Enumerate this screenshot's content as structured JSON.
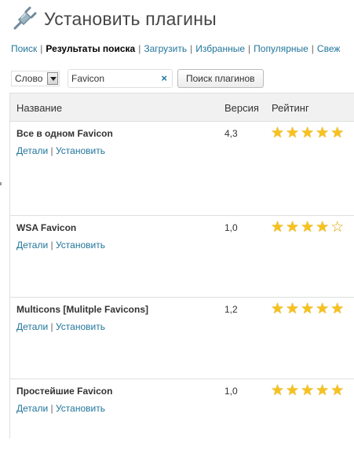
{
  "page": {
    "title": "Установить плагины"
  },
  "subnav": [
    {
      "label": "Поиск",
      "current": false
    },
    {
      "label": "Результаты поиска",
      "current": true
    },
    {
      "label": "Загрузить",
      "current": false
    },
    {
      "label": "Избранные",
      "current": false
    },
    {
      "label": "Популярные",
      "current": false
    },
    {
      "label": "Свеж",
      "current": false
    }
  ],
  "search": {
    "type_value": "Слово",
    "query": "Favicon",
    "clear_icon": "×",
    "button_label": "Поиск плагинов"
  },
  "table": {
    "headers": {
      "name": "Название",
      "version": "Версия",
      "rating": "Рейтинг"
    },
    "rows": [
      {
        "name": "Все в одном Favicon",
        "version": "4,3",
        "rating": 5
      },
      {
        "name": "WSA Favicon",
        "version": "1,0",
        "rating": 4
      },
      {
        "name": "Multicons [Mulitple Favicons]",
        "version": "1,2",
        "rating": 5
      },
      {
        "name": "Простейшие Favicon",
        "version": "1,0",
        "rating": 5
      }
    ],
    "details_label": "Детали",
    "install_label": "Установить",
    "link_separator": "|"
  },
  "colors": {
    "link": "#21759b",
    "star": "#f7c21c",
    "header_bg": "#f1f1f1",
    "border": "#dfdfdf"
  },
  "icons": {
    "page_icon": "plug-icon",
    "star_full": "★",
    "star_empty": "☆"
  }
}
